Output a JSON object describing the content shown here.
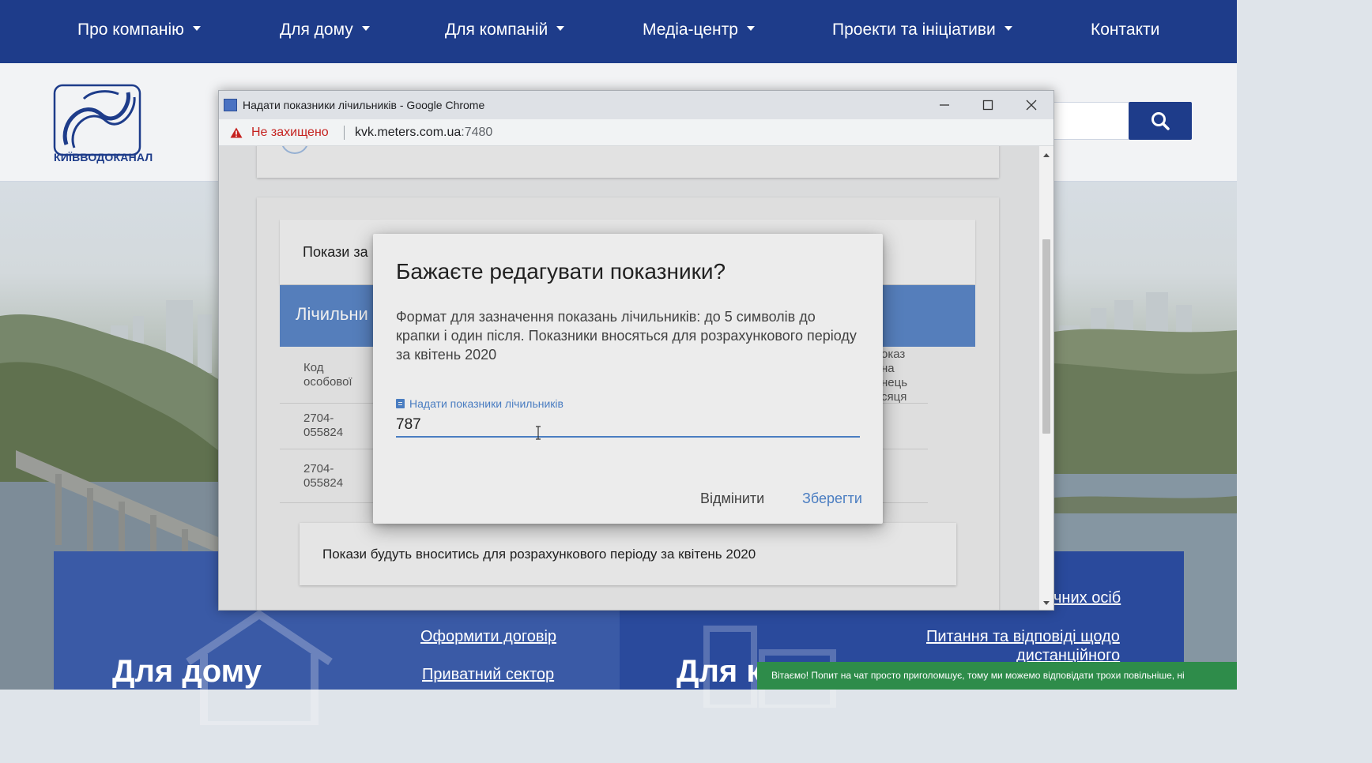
{
  "nav": {
    "items": [
      {
        "label": "Про компанію",
        "dropdown": true
      },
      {
        "label": "Для дому",
        "dropdown": true
      },
      {
        "label": "Для компаній",
        "dropdown": true
      },
      {
        "label": "Медіа-центр",
        "dropdown": true
      },
      {
        "label": "Проекти та ініціативи",
        "dropdown": true
      },
      {
        "label": "Контакти",
        "dropdown": false
      }
    ]
  },
  "header": {
    "logo_text": "КИЇВВОДОКАНАЛ",
    "search_icon": "search-icon"
  },
  "banner": {
    "left_title": "Для дому",
    "left_links": [
      "Оформити договір",
      "Приватний сектор"
    ],
    "right_title": "Для к",
    "right_links": [
      "чних осіб",
      "Питання та відповіді щодо",
      "дистанційного"
    ]
  },
  "chat": {
    "text": "Вітаємо! Попит на чат просто приголомшує, тому ми можемо відповідати трохи повільніше, ні"
  },
  "chrome": {
    "title": "Надати показники лічильників - Google Chrome",
    "not_secure": "Не захищено",
    "url_host": "kvk.meters.com.ua",
    "url_port": ":7480"
  },
  "page": {
    "card_label": "Покази за",
    "band_label": "Лічильни",
    "col_code": "Код особової",
    "col_right": "оказ на нець сяця",
    "rows": [
      "2704-055824",
      "2704-055824"
    ],
    "info": "Покази будуть вноситись для розрахункового періоду за квітень 2020"
  },
  "dialog": {
    "title": "Бажаєте редагувати показники?",
    "description": "Формат для зазначення показань лічильників: до 5 символів до крапки і один після. Показники вносяться для розрахункового періоду за квітень 2020",
    "field_label": "Надати показники лічильників",
    "field_value": "787",
    "cancel": "Відмінити",
    "save": "Зберегти"
  },
  "colors": {
    "nav_bg": "#1e3c8a",
    "accent": "#4a7dc1",
    "band": "#5b86c7",
    "chat": "#2e8c4a",
    "warning": "#c5221f"
  }
}
